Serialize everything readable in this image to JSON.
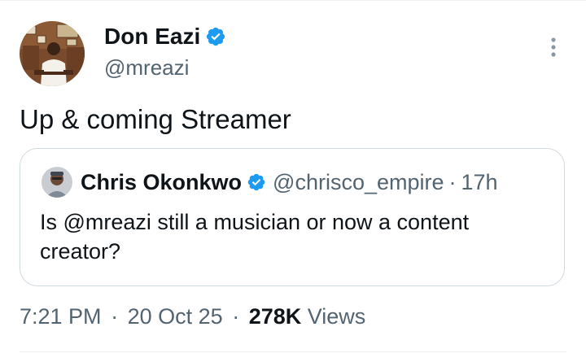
{
  "colors": {
    "verified_badge": "#1d9bf0",
    "secondary_text": "#536471",
    "primary_text": "#0f1419",
    "card_border": "#cfd9de"
  },
  "post": {
    "author": {
      "name": "Don Eazi",
      "handle": "@mreazi",
      "verified": true,
      "avatar_icon": "profile-photo"
    },
    "more_icon": "more-vertical-icon",
    "text": "Up & coming Streamer",
    "quoted": {
      "author_name": "Chris Okonkwo",
      "verified": true,
      "handle": "@chrisco_empire",
      "separator": "·",
      "time": "17h",
      "text": "Is @mreazi still a musician or now a content creator?"
    },
    "meta": {
      "time": "7:21 PM",
      "separator1": "·",
      "date": "20 Oct 25",
      "separator2": "·",
      "views_count": "278K",
      "views_label": "Views"
    }
  }
}
